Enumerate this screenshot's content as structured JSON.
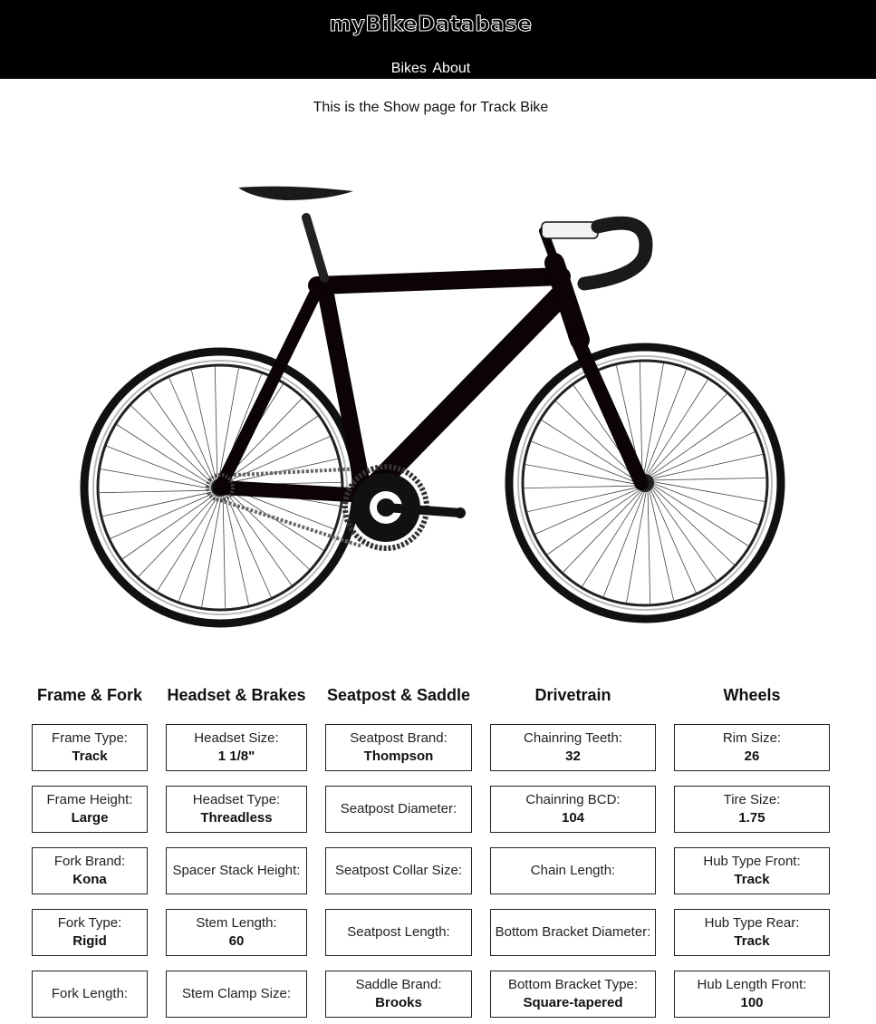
{
  "header": {
    "brand": "myBikeDatabase",
    "nav": [
      "Bikes",
      "About"
    ]
  },
  "page": {
    "subtitle": "This is the Show page for Track Bike"
  },
  "colors": {
    "header_bg": "#000000",
    "text": "#111111",
    "border": "#222222"
  },
  "image": {
    "icon": "track-bike-photo"
  },
  "sections": [
    {
      "title": "Frame & Fork",
      "fields": [
        {
          "label": "Frame Type:",
          "value": "Track"
        },
        {
          "label": "Frame Height:",
          "value": "Large"
        },
        {
          "label": "Fork Brand:",
          "value": "Kona"
        },
        {
          "label": "Fork Type:",
          "value": "Rigid"
        },
        {
          "label": "Fork Length:",
          "value": ""
        }
      ]
    },
    {
      "title": "Headset & Brakes",
      "fields": [
        {
          "label": "Headset Size:",
          "value": "1 1/8\""
        },
        {
          "label": "Headset Type:",
          "value": "Threadless"
        },
        {
          "label": "Spacer Stack Height:",
          "value": ""
        },
        {
          "label": "Stem Length:",
          "value": "60"
        },
        {
          "label": "Stem Clamp Size:",
          "value": ""
        }
      ]
    },
    {
      "title": "Seatpost & Saddle",
      "fields": [
        {
          "label": "Seatpost Brand:",
          "value": "Thompson"
        },
        {
          "label": "Seatpost Diameter:",
          "value": ""
        },
        {
          "label": "Seatpost Collar Size:",
          "value": ""
        },
        {
          "label": "Seatpost Length:",
          "value": ""
        },
        {
          "label": "Saddle Brand:",
          "value": "Brooks"
        }
      ]
    },
    {
      "title": "Drivetrain",
      "fields": [
        {
          "label": "Chainring Teeth:",
          "value": "32"
        },
        {
          "label": "Chainring BCD:",
          "value": "104"
        },
        {
          "label": "Chain Length:",
          "value": ""
        },
        {
          "label": "Bottom Bracket Diameter:",
          "value": ""
        },
        {
          "label": "Bottom Bracket Type:",
          "value": "Square-tapered"
        }
      ]
    },
    {
      "title": "Wheels",
      "fields": [
        {
          "label": "Rim Size:",
          "value": "26"
        },
        {
          "label": "Tire Size:",
          "value": "1.75"
        },
        {
          "label": "Hub Type Front:",
          "value": "Track"
        },
        {
          "label": "Hub Type Rear:",
          "value": "Track"
        },
        {
          "label": "Hub Length Front:",
          "value": "100"
        }
      ]
    }
  ]
}
